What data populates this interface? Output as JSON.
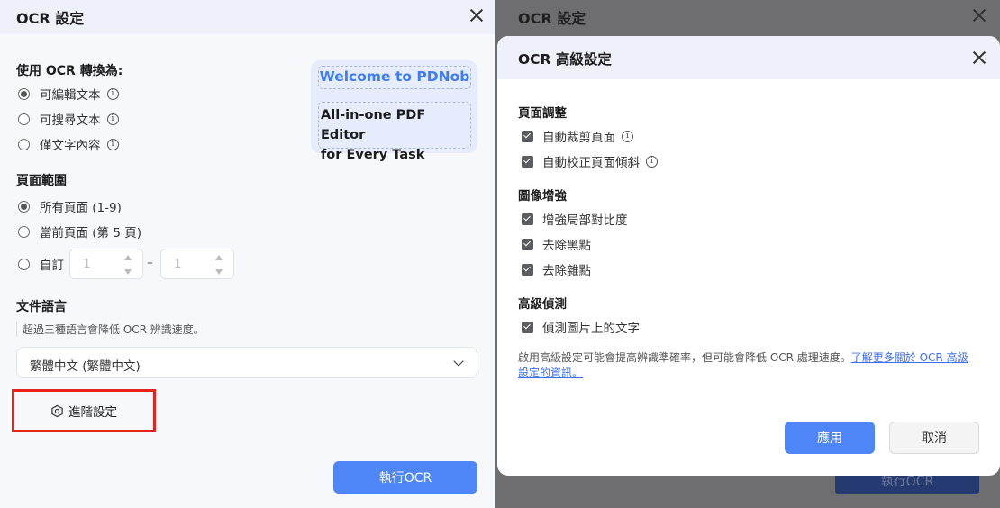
{
  "left_dialog": {
    "title": "OCR 設定",
    "convert_section": {
      "title": "使用 OCR 轉換為:",
      "options": [
        {
          "label": "可編輯文本",
          "selected": true
        },
        {
          "label": "可搜尋文本",
          "selected": false
        },
        {
          "label": "僅文字內容",
          "selected": false
        }
      ]
    },
    "page_range": {
      "title": "頁面範圍",
      "options": [
        {
          "label": "所有頁面 (1-9)",
          "selected": true
        },
        {
          "label": "當前頁面 (第 5 頁)",
          "selected": false
        },
        {
          "label": "自訂",
          "selected": false
        }
      ],
      "from_value": "1",
      "separator": "–",
      "to_value": "1"
    },
    "language": {
      "title": "文件語言",
      "note": "超過三種語言會降低 OCR 辨識速度。",
      "selected": "繁體中文 (繁體中文)"
    },
    "advanced_button": "進階設定",
    "run_button": "執行OCR",
    "promo": {
      "line1": "Welcome to PDNob",
      "line2a": "All-in-one PDF Editor",
      "line2b": "for Every Task"
    }
  },
  "background_dialog": {
    "title": "OCR 設定",
    "run_button": "執行OCR"
  },
  "advanced_modal": {
    "title": "OCR 高級設定",
    "sections": [
      {
        "title": "頁面調整",
        "items": [
          {
            "label": "自動裁剪頁面",
            "checked": true,
            "info": true
          },
          {
            "label": "自動校正頁面傾斜",
            "checked": true,
            "info": true
          }
        ]
      },
      {
        "title": "圖像增強",
        "items": [
          {
            "label": "增強局部對比度",
            "checked": true
          },
          {
            "label": "去除黑點",
            "checked": true
          },
          {
            "label": "去除雜點",
            "checked": true
          }
        ]
      },
      {
        "title": "高級偵測",
        "items": [
          {
            "label": "偵測圖片上的文字",
            "checked": true
          }
        ]
      }
    ],
    "note": "啟用高級設定可能會提高辨識準確率，但可能會降低 OCR 處理速度。",
    "link": "了解更多關於 OCR 高級設定的資訊。",
    "apply_button": "應用",
    "cancel_button": "取消"
  },
  "colors": {
    "accent": "#4e86f7",
    "highlight": "#e8231e",
    "overlay": "#6e6e70"
  }
}
